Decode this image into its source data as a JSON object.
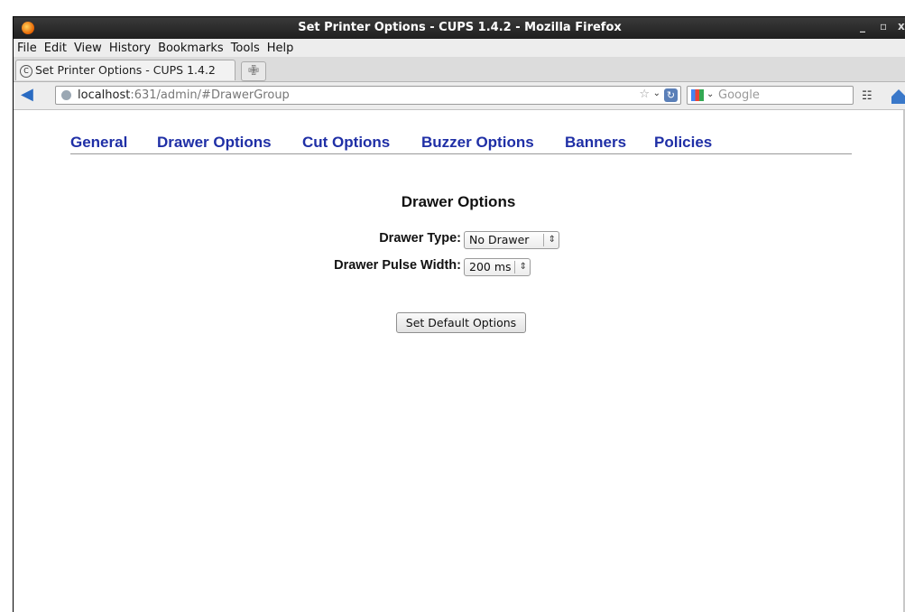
{
  "window": {
    "title": "Set Printer Options - CUPS 1.4.2 - Mozilla Firefox",
    "controls": [
      "_",
      "▫",
      "x"
    ]
  },
  "menu": [
    "File",
    "Edit",
    "View",
    "History",
    "Bookmarks",
    "Tools",
    "Help"
  ],
  "tab": {
    "label": "Set Printer Options - CUPS 1.4.2",
    "new_tab_glyph": "✙"
  },
  "navigation": {
    "back_glyph": "◀",
    "url_host": "localhost",
    "url_rest": ":631/admin/#DrawerGroup",
    "search_placeholder": "Google",
    "reload_glyph": "↻",
    "star_glyph": "☆",
    "dropdown_glyph": "⌄",
    "binoculars_glyph": "☷"
  },
  "cups_tabs": [
    "General",
    "Drawer Options",
    "Cut Options",
    "Buzzer Options",
    "Banners",
    "Policies"
  ],
  "section": {
    "title": "Drawer Options",
    "fields": [
      {
        "label": "Drawer Type:",
        "value": "No Drawer"
      },
      {
        "label": "Drawer Pulse Width:",
        "value": "200 ms"
      }
    ],
    "submit_label": "Set Default Options"
  },
  "colors": {
    "link": "#1f2fa6",
    "titlebar": "#2a2a2a"
  },
  "icons": {
    "app": "firefox-icon",
    "back": "back-arrow-icon",
    "site": "globe-icon",
    "search_engine": "google-icon"
  }
}
